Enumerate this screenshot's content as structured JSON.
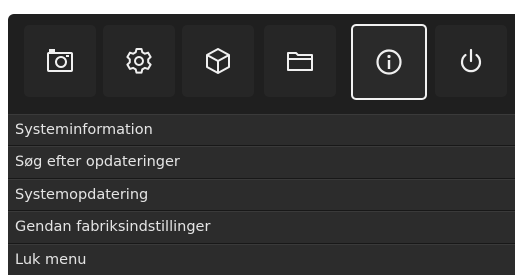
{
  "toolbar": {
    "icons": [
      {
        "name": "camera-settings-icon",
        "selected": false
      },
      {
        "name": "gear-icon",
        "selected": false
      },
      {
        "name": "cube-icon",
        "selected": false
      },
      {
        "name": "folder-icon",
        "selected": false
      },
      {
        "name": "info-icon",
        "selected": true
      },
      {
        "name": "power-icon",
        "selected": false
      }
    ]
  },
  "menu": {
    "items": [
      {
        "label": "Systeminformation"
      },
      {
        "label": "Søg efter opdateringer"
      },
      {
        "label": "Systemopdatering"
      },
      {
        "label": "Gendan fabriksindstillinger"
      },
      {
        "label": "Luk menu"
      }
    ]
  },
  "colors": {
    "panel_bg": "#1f1f1f",
    "item_bg": "#2c2c2c",
    "text": "#e4e4e4",
    "selected_border": "#f2f2f2"
  }
}
